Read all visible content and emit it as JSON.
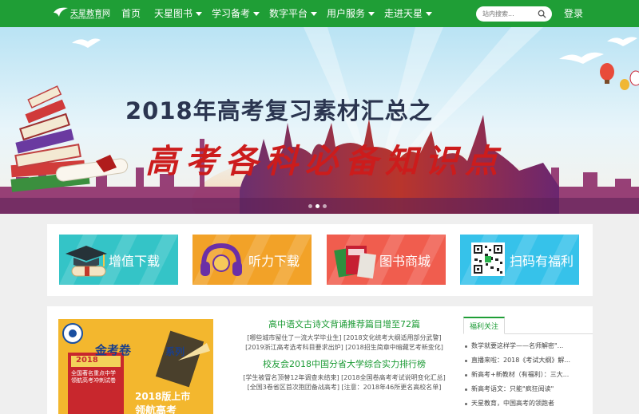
{
  "nav": {
    "logo_text": "天星教育网",
    "logo_sub": "www.tesoon.com",
    "items": [
      {
        "label": "首页",
        "has_caret": false
      },
      {
        "label": "天星图书",
        "has_caret": true
      },
      {
        "label": "学习备考",
        "has_caret": true
      },
      {
        "label": "数字平台",
        "has_caret": true
      },
      {
        "label": "用户服务",
        "has_caret": true
      },
      {
        "label": "走进天星",
        "has_caret": true
      }
    ],
    "search_placeholder": "站内搜索...",
    "login_label": "登录",
    "colors": {
      "bar": "#1f9e36"
    }
  },
  "banner": {
    "title": "2018年高考复习素材汇总之",
    "subtitle": "高考各科必备知识点"
  },
  "quick": {
    "tiles": [
      {
        "label": "增值下载",
        "icon": "graduation-cap-icon",
        "color": "#34c4c7"
      },
      {
        "label": "听力下载",
        "icon": "headphones-icon",
        "color": "#f2a228"
      },
      {
        "label": "图书商城",
        "icon": "books-icon",
        "color": "#f05d4e"
      },
      {
        "label": "扫码有福利",
        "icon": "qr-code-icon",
        "color": "#36c2ea"
      }
    ]
  },
  "promo": {
    "brand": "金考卷",
    "series": "系列",
    "edition": "2018版上市",
    "cover_line": "全国著名重点中学领航高考冲刺试卷",
    "lead": "领航高考",
    "badge_year": "2018"
  },
  "news": {
    "headline1": "高中语文古诗文背诵推荐篇目增至72篇",
    "line1a": "[哪些城市留住了一流大学毕业生] [2018文化统考大纲适用部分武警]",
    "line1b": "[2019浙江高考选考科目要求出炉] [2018招生简章中暗藏艺考新变化]",
    "headline2": "校友会2018中国分省大学综合实力排行榜",
    "line2a": "[学生被冒名顶替12年调查未结束] [2018全国卷高考考试说明变化汇总]",
    "line2b": "[全国3卷省区首次抱团备战高考] [注意：2018年46所更名高校名单]"
  },
  "sidebar": {
    "tab": "福利关注",
    "items": [
      "数学就要这样学——名师解密\"...",
      "直播来啦：2018《考试大纲》解...",
      "新高考+新教材（有福利）：三大...",
      "新高考语文：只能\"疯狂阅读\"",
      "天星教育，中国高考的领跑者"
    ]
  }
}
